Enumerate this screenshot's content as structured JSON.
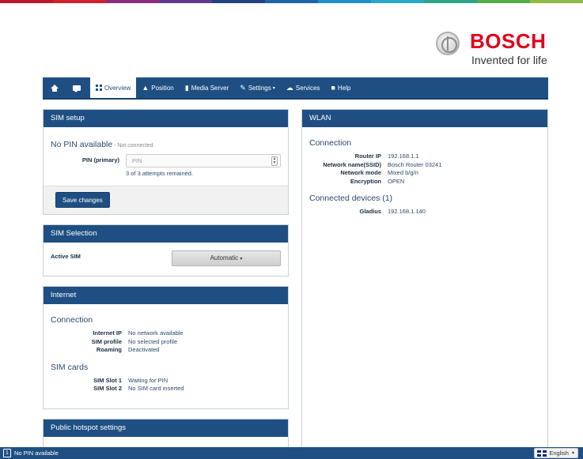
{
  "brand": {
    "name": "BOSCH",
    "tagline": "Invented for life",
    "strip_colors": [
      "#b8172e",
      "#d0202b",
      "#8a2c7e",
      "#5b3a8c",
      "#22427e",
      "#1e64a8",
      "#1f8fce",
      "#27a9c7",
      "#2aa58a",
      "#58a94a",
      "#8fba43"
    ]
  },
  "nav": {
    "items": [
      {
        "label": "",
        "icon": "home-icon"
      },
      {
        "label": "",
        "icon": "chat-icon"
      },
      {
        "label": "Overview",
        "icon": "grid-icon",
        "active": true
      },
      {
        "label": "Position",
        "icon": "person-icon"
      },
      {
        "label": "Media Server",
        "icon": "file-icon"
      },
      {
        "label": "Settings",
        "icon": "wrench-icon"
      },
      {
        "label": "Services",
        "icon": "cloud-icon"
      },
      {
        "label": "Help",
        "icon": "book-icon"
      }
    ]
  },
  "sim_setup": {
    "title": "SIM setup",
    "status_title": "No PIN available",
    "status_sub": " - Not connected",
    "pin_label": "PIN (primary)",
    "pin_placeholder": "PIN",
    "pin_hint": "3 of 3 attempts remained.",
    "save_label": "Save changes"
  },
  "sim_selection": {
    "title": "SIM Selection",
    "active_label": "Active SIM",
    "active_value": "Automatic"
  },
  "internet": {
    "title": "Internet",
    "connection_title": "Connection",
    "connection": [
      {
        "key": "Internet IP",
        "value": "No network available"
      },
      {
        "key": "SIM profile",
        "value": "No selected profile"
      },
      {
        "key": "Roaming",
        "value": "Deactivated"
      }
    ],
    "sim_cards_title": "SIM cards",
    "sim_cards": [
      {
        "key": "SIM Slot 1",
        "value": "Waiting for PIN"
      },
      {
        "key": "SIM Slot 2",
        "value": "No SIM card inserted"
      }
    ]
  },
  "hotspot": {
    "title": "Public hotspot settings"
  },
  "wlan": {
    "title": "WLAN",
    "connection_title": "Connection",
    "connection": [
      {
        "key": "Router IP",
        "value": "192.168.1.1"
      },
      {
        "key": "Network name(SSID)",
        "value": "Bosch Router 03241"
      },
      {
        "key": "Network mode",
        "value": "Mixed b/g/n"
      },
      {
        "key": "Encryption",
        "value": "OPEN"
      }
    ],
    "devices_title": "Connected devices (1)",
    "devices": [
      {
        "key": "Gladius",
        "value": "192.168.1.140"
      }
    ]
  },
  "statusbar": {
    "badge": "1",
    "text": "No PIN available",
    "language": "English"
  }
}
